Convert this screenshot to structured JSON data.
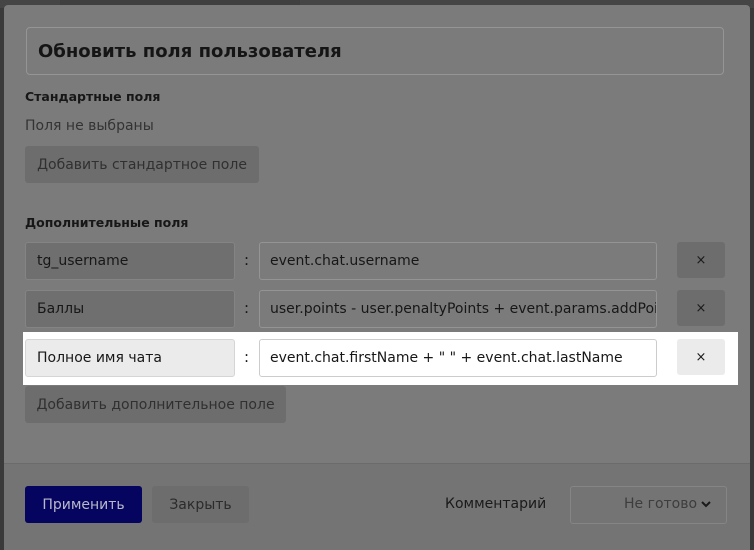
{
  "dialog": {
    "title": "Обновить поля пользователя",
    "standard_fields": {
      "label": "Стандартные поля",
      "empty_text": "Поля не выбраны",
      "add_button": "Добавить стандартное поле"
    },
    "custom_fields": {
      "label": "Дополнительные поля",
      "separator": ":",
      "remove_glyph": "×",
      "rows": [
        {
          "key": "tg_username",
          "value": "event.chat.username"
        },
        {
          "key": "Баллы",
          "value": "user.points - user.penaltyPoints + event.params.addPoin"
        },
        {
          "key": "Полное имя чата",
          "value": "event.chat.firstName + \" \" + event.chat.lastName"
        }
      ],
      "add_button": "Добавить дополнительное поле"
    }
  },
  "footer": {
    "apply_button": "Применить",
    "close_button": "Закрыть",
    "comment_link": "Комментарий",
    "status_select": {
      "value": "Не готово",
      "icon": "chevron-down-icon"
    }
  },
  "colors": {
    "overlay_dim": "#7b7b7b",
    "primary": "#050560",
    "highlight": "#ffffff"
  }
}
